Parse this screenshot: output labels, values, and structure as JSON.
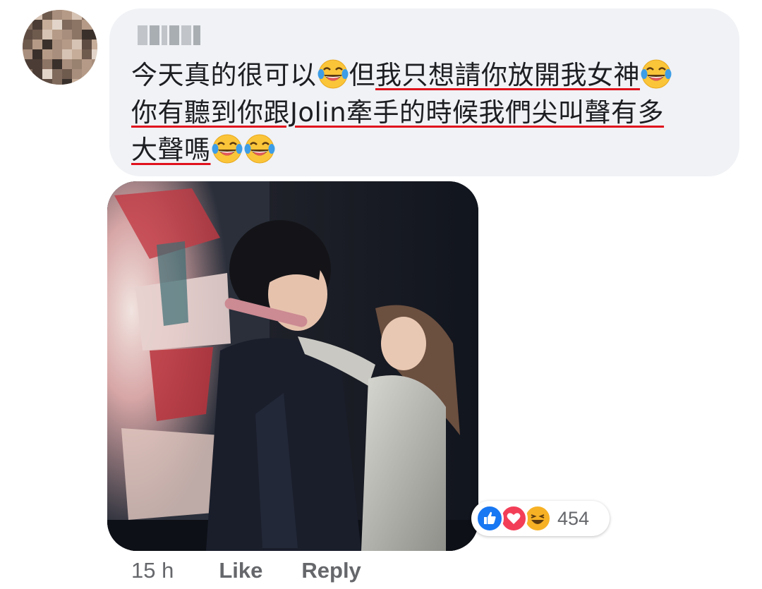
{
  "comment": {
    "author_name": "",
    "lines": [
      {
        "segments": [
          {
            "text": "今天真的很可以",
            "underline": false
          },
          {
            "emoji": "laugh-cry"
          },
          {
            "text": "但",
            "underline": false
          },
          {
            "text": "我只想請你放開我女神",
            "underline": true
          },
          {
            "emoji": "laugh-cry"
          }
        ]
      },
      {
        "segments": [
          {
            "text": "你有聽到你跟Jolin牽手的時候我們尖叫聲有多",
            "underline": true
          }
        ]
      },
      {
        "segments": [
          {
            "text": "大聲嗎",
            "underline": true
          },
          {
            "emoji": "laugh-cry"
          },
          {
            "emoji": "laugh-cry"
          }
        ]
      }
    ],
    "underline_color": "#e0121d"
  },
  "reactions": {
    "icons": [
      "like-icon",
      "love-icon",
      "haha-icon"
    ],
    "count": "454"
  },
  "footer": {
    "time": "15 h",
    "like_label": "Like",
    "reply_label": "Reply"
  },
  "colors": {
    "bubble": "#f0f2f5",
    "text": "#1c1e21",
    "secondary": "#65676b",
    "like_blue": "#1877f2",
    "love_red": "#f33e58",
    "haha_yellow": "#f7b125"
  }
}
